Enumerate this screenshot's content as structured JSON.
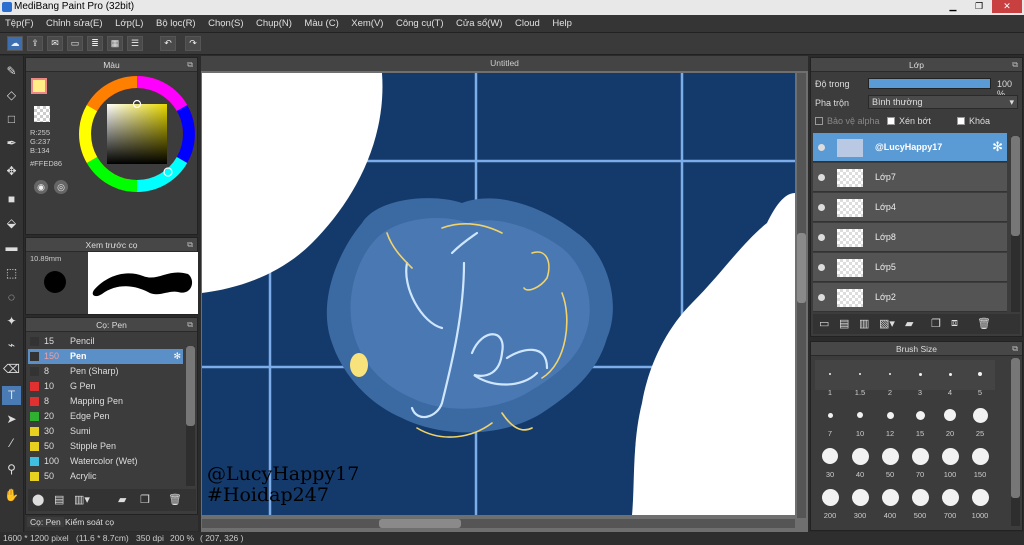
{
  "window": {
    "title": "MediBang Paint Pro (32bit)"
  },
  "menu": [
    "Tệp(F)",
    "Chỉnh sửa(E)",
    "Lớp(L)",
    "Bộ lọc(R)",
    "Chọn(S)",
    "Chụp(N)",
    "Màu (C)",
    "Xem(V)",
    "Công cụ(T)",
    "Cửa sổ(W)",
    "Cloud",
    "Help"
  ],
  "color_panel": {
    "title": "Màu",
    "r": "R:255",
    "g": "G:237",
    "b": "B:134",
    "hex": "#FFED86",
    "primary_color": "#FFED86"
  },
  "preview_panel": {
    "title": "Xem trước cọ",
    "size": "10.89mm"
  },
  "brush_panel": {
    "title": "Cọ: Pen",
    "brushes": [
      {
        "size": "15",
        "name": "Pencil",
        "color": "#333333"
      },
      {
        "size": "150",
        "name": "Pen",
        "color": "#333333",
        "selected": true
      },
      {
        "size": "8",
        "name": "Pen (Sharp)",
        "color": "#333333"
      },
      {
        "size": "10",
        "name": "G Pen",
        "color": "#e03030"
      },
      {
        "size": "8",
        "name": "Mapping Pen",
        "color": "#e03030"
      },
      {
        "size": "20",
        "name": "Edge Pen",
        "color": "#30b030"
      },
      {
        "size": "30",
        "name": "Sumi",
        "color": "#e8d020"
      },
      {
        "size": "50",
        "name": "Stipple Pen",
        "color": "#e8d020"
      },
      {
        "size": "100",
        "name": "Watercolor (Wet)",
        "color": "#40c0e0"
      },
      {
        "size": "50",
        "name": "Acrylic",
        "color": "#e8d020"
      }
    ]
  },
  "bottom_tabs": [
    "Cọ: Pen",
    "Kiểm soát cọ"
  ],
  "canvas": {
    "tab": "Untitled",
    "watermark1": "@LucyHappy17",
    "watermark2": "#Hoidap247"
  },
  "layer_panel": {
    "title": "Lớp",
    "opacity_label": "Độ trong",
    "opacity_value": "100 %",
    "opacity_fraction": 1.0,
    "blend_label": "Pha trộn",
    "blend_value": "Bình thường",
    "protect_alpha": "Bảo vệ alpha",
    "clipping": "Xén bớt",
    "lock": "Khóa",
    "layers": [
      "@LucyHappy17",
      "Lớp7",
      "Lớp4",
      "Lớp8",
      "Lớp5",
      "Lớp2"
    ]
  },
  "brush_size_panel": {
    "title": "Brush Size",
    "sizes": [
      "1",
      "1.5",
      "2",
      "3",
      "4",
      "5",
      "7",
      "10",
      "12",
      "15",
      "20",
      "25",
      "30",
      "40",
      "50",
      "70",
      "100",
      "150",
      "200",
      "300",
      "400",
      "500",
      "700",
      "1000"
    ]
  },
  "status": {
    "dims": "1600 * 1200 pixel",
    "cm": "(11.6 * 8.7cm)",
    "dpi": "350 dpi",
    "zoom": "200 %",
    "coord": "( 207, 326 )"
  }
}
